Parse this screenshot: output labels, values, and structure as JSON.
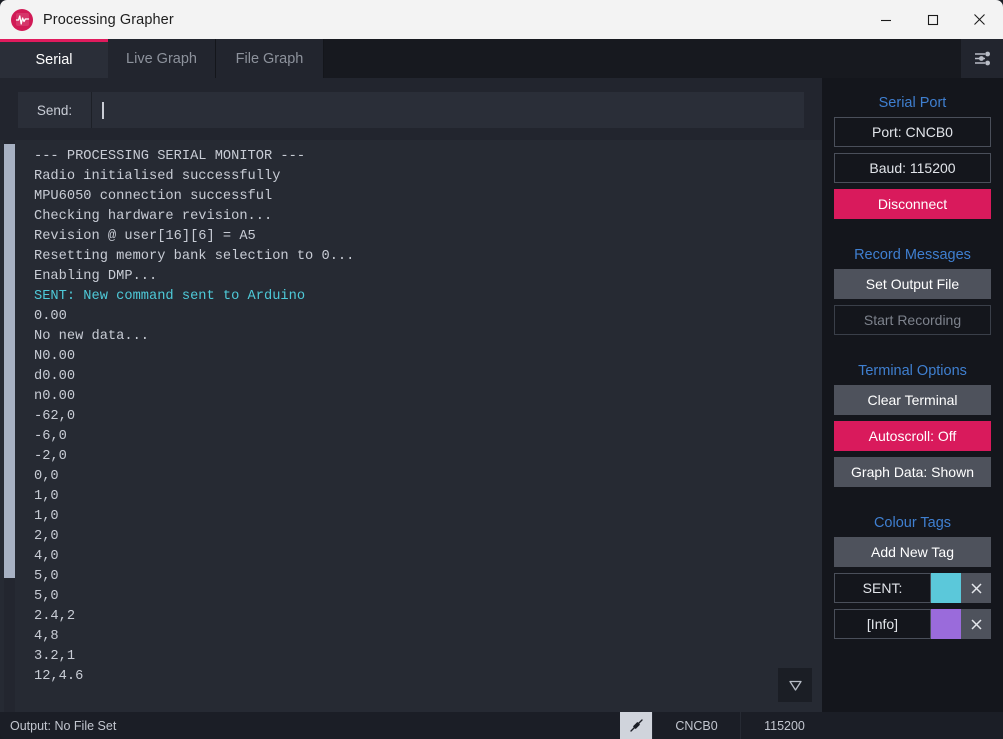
{
  "window": {
    "title": "Processing Grapher",
    "icon": "waveform-icon",
    "controls": {
      "minimize": "minimize-icon",
      "maximize": "maximize-icon",
      "close": "close-icon"
    }
  },
  "tabs": [
    {
      "label": "Serial",
      "active": true
    },
    {
      "label": "Live Graph",
      "active": false
    },
    {
      "label": "File Graph",
      "active": false
    }
  ],
  "settings_button": {
    "icon": "sliders-icon"
  },
  "send": {
    "label": "Send:",
    "value": "",
    "placeholder": ""
  },
  "terminal": {
    "scroll_bottom_icon": "triangle-down-icon",
    "lines": [
      {
        "text": "--- PROCESSING SERIAL MONITOR ---",
        "color": "#c8ccd5"
      },
      {
        "text": "Radio initialised successfully",
        "color": "#c8ccd5"
      },
      {
        "text": "MPU6050 connection successful",
        "color": "#c8ccd5"
      },
      {
        "text": "Checking hardware revision...",
        "color": "#c8ccd5"
      },
      {
        "text": "Revision @ user[16][6] = A5",
        "color": "#c8ccd5"
      },
      {
        "text": "Resetting memory bank selection to 0...",
        "color": "#c8ccd5"
      },
      {
        "text": "Enabling DMP...",
        "color": "#c8ccd5"
      },
      {
        "text": "SENT: New command sent to Arduino",
        "color": "#4ec9d8"
      },
      {
        "text": "0.00",
        "color": "#c8ccd5"
      },
      {
        "text": "No new data...",
        "color": "#c8ccd5"
      },
      {
        "text": "N0.00",
        "color": "#c8ccd5"
      },
      {
        "text": "d0.00",
        "color": "#c8ccd5"
      },
      {
        "text": "n0.00",
        "color": "#c8ccd5"
      },
      {
        "text": "-62,0",
        "color": "#c8ccd5"
      },
      {
        "text": "-6,0",
        "color": "#c8ccd5"
      },
      {
        "text": "-2,0",
        "color": "#c8ccd5"
      },
      {
        "text": "0,0",
        "color": "#c8ccd5"
      },
      {
        "text": "1,0",
        "color": "#c8ccd5"
      },
      {
        "text": "1,0",
        "color": "#c8ccd5"
      },
      {
        "text": "2,0",
        "color": "#c8ccd5"
      },
      {
        "text": "4,0",
        "color": "#c8ccd5"
      },
      {
        "text": "5,0",
        "color": "#c8ccd5"
      },
      {
        "text": "5,0",
        "color": "#c8ccd5"
      },
      {
        "text": "2.4,2",
        "color": "#c8ccd5"
      },
      {
        "text": "4,8",
        "color": "#c8ccd5"
      },
      {
        "text": "3.2,1",
        "color": "#c8ccd5"
      },
      {
        "text": "12,4.6",
        "color": "#c8ccd5"
      }
    ]
  },
  "sidebar": {
    "serial_port": {
      "heading": "Serial Port",
      "port_button": "Port: CNCB0",
      "baud_button": "Baud: 115200",
      "connect_button": "Disconnect"
    },
    "record_messages": {
      "heading": "Record Messages",
      "set_output_file": "Set Output File",
      "start_recording": "Start Recording"
    },
    "terminal_options": {
      "heading": "Terminal Options",
      "clear_terminal": "Clear Terminal",
      "autoscroll": "Autoscroll: Off",
      "graph_data": "Graph Data: Shown"
    },
    "colour_tags": {
      "heading": "Colour Tags",
      "add_new_tag": "Add New Tag",
      "tags": [
        {
          "name": "SENT:",
          "colour": "#5bc8da"
        },
        {
          "name": "[Info]",
          "colour": "#9a6bdb"
        }
      ]
    }
  },
  "statusbar": {
    "output": "Output: No File Set",
    "plug_icon": "plug-icon",
    "port": "CNCB0",
    "baud": "115200"
  },
  "colors": {
    "accent": "#d91a5c",
    "heading": "#3f7fd0",
    "terminal_bg": "#262a33",
    "panel_bg": "#22252e",
    "sidebar_bg": "#14161c"
  }
}
